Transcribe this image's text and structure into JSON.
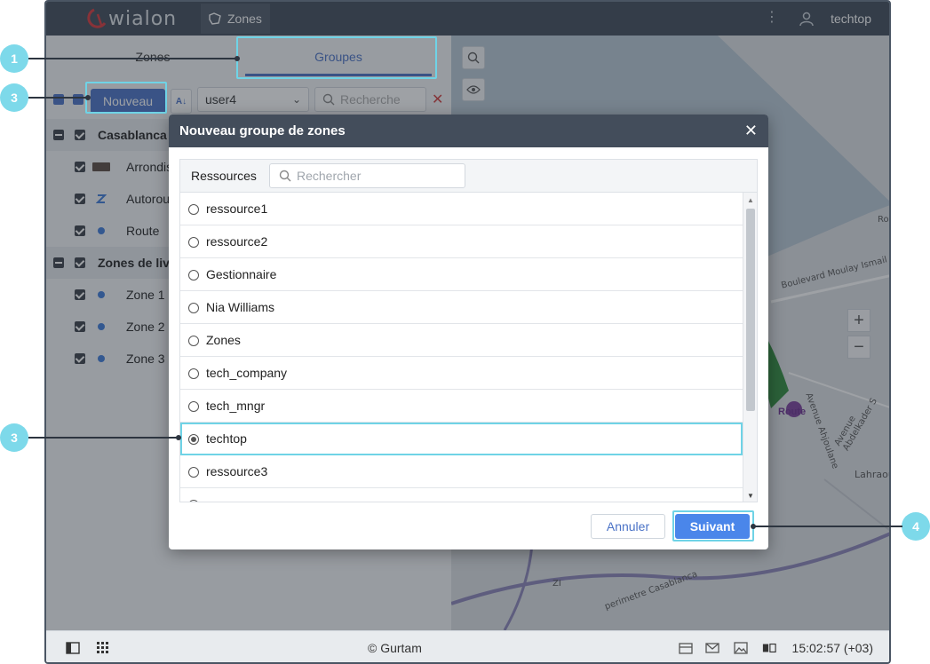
{
  "topbar": {
    "logo_text": "wialon",
    "active_app": "Zones",
    "user_name": "techtop",
    "menu_icon": "kebab-menu-icon"
  },
  "left_panel": {
    "tabs": [
      {
        "label": "Zones",
        "active": false
      },
      {
        "label": "Groupes",
        "active": true
      }
    ],
    "toolbar": {
      "new_button": "Nouveau",
      "sort_label": "A↓",
      "user_select": "user4",
      "search_placeholder": "Recherche"
    },
    "tree": [
      {
        "label": "Casablanca (",
        "group": true
      },
      {
        "label": "Arrondis",
        "group": false,
        "marker": "image"
      },
      {
        "label": "Autorou",
        "group": false,
        "marker": "line"
      },
      {
        "label": "Route",
        "group": false,
        "marker": "dot"
      },
      {
        "label": "Zones de livr",
        "group": true
      },
      {
        "label": "Zone 1",
        "group": false,
        "marker": "dot"
      },
      {
        "label": "Zone 2",
        "group": false,
        "marker": "dot"
      },
      {
        "label": "Zone 3",
        "group": false,
        "marker": "dot"
      }
    ]
  },
  "map": {
    "labels": {
      "road1": "Boulevard Moulay Ismail",
      "road2": "Avenue Ahjoulane",
      "road3": "Avenue Abdelkader S",
      "place1": "Lahraou",
      "road4": "perimetre Casablanca",
      "road5": "Rou",
      "place2": "Route",
      "zi": "ZI"
    },
    "zoom_in": "+",
    "zoom_out": "−"
  },
  "dialog": {
    "title": "Nouveau groupe de zones",
    "resources_label": "Ressources",
    "search_placeholder": "Rechercher",
    "resources": [
      {
        "name": "ressource1",
        "selected": false
      },
      {
        "name": "ressource2",
        "selected": false
      },
      {
        "name": "Gestionnaire",
        "selected": false
      },
      {
        "name": "Nia Williams",
        "selected": false
      },
      {
        "name": "Zones",
        "selected": false
      },
      {
        "name": "tech_company",
        "selected": false
      },
      {
        "name": "tech_mngr",
        "selected": false
      },
      {
        "name": "techtop",
        "selected": true
      },
      {
        "name": "ressource3",
        "selected": false
      },
      {
        "name": "user",
        "selected": false
      }
    ],
    "cancel_button": "Annuler",
    "next_button": "Suivant"
  },
  "statusbar": {
    "copyright": "© Gurtam",
    "time": "15:02:57 (+03)"
  },
  "callouts": [
    "1",
    "3",
    "3",
    "4"
  ],
  "colors": {
    "accent": "#4a72c6",
    "highlight": "#6fd3e6",
    "header": "#434d5b"
  }
}
